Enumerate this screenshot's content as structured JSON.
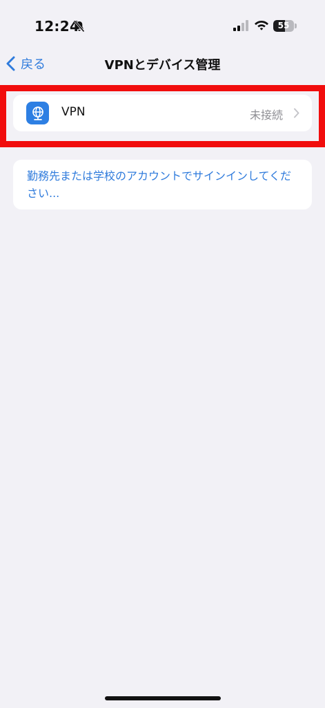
{
  "status_bar": {
    "time": "12:24",
    "battery_level": "55",
    "battery_fraction": 0.55,
    "icons": [
      "bell-slash-icon",
      "cellular-signal-icon",
      "wifi-icon",
      "battery-icon"
    ]
  },
  "nav": {
    "back_label": "戻る",
    "title": "VPNとデバイス管理"
  },
  "vpn_row": {
    "label": "VPN",
    "status": "未接続",
    "icon": "globe-network-icon",
    "icon_color": "#2d7fe3"
  },
  "signin": {
    "text": "勤務先または学校のアカウントでサインインしてください..."
  },
  "colors": {
    "background": "#f2f1f6",
    "accent": "#2f7bdc",
    "highlight": "#f10d0d"
  }
}
